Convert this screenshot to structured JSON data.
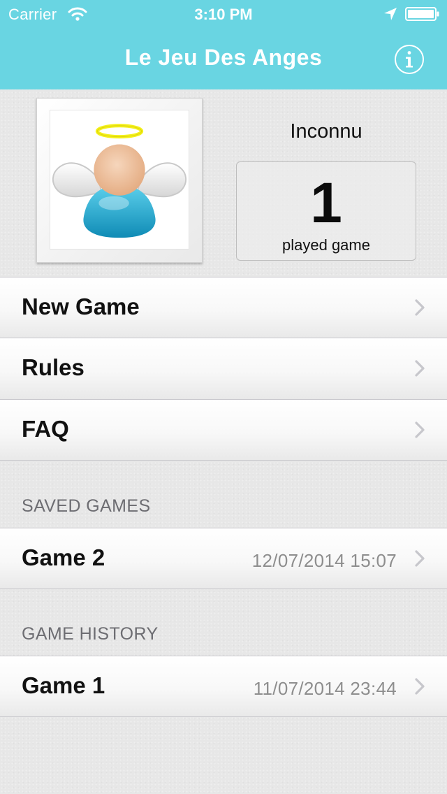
{
  "status_bar": {
    "carrier": "Carrier",
    "time": "3:10 PM",
    "icons": [
      "wifi-icon",
      "location-arrow-icon",
      "battery-icon"
    ]
  },
  "nav": {
    "title": "Le Jeu Des Anges",
    "info_icon": "info-icon"
  },
  "profile": {
    "avatar_icon": "angel-avatar-icon",
    "name": "Inconnu",
    "played_count": "1",
    "played_label": "played game"
  },
  "menu": {
    "items": [
      {
        "label": "New Game"
      },
      {
        "label": "Rules"
      },
      {
        "label": "FAQ"
      }
    ]
  },
  "saved_games": {
    "header": "SAVED GAMES",
    "items": [
      {
        "title": "Game 2",
        "date": "12/07/2014 15:07"
      }
    ]
  },
  "game_history": {
    "header": "GAME HISTORY",
    "items": [
      {
        "title": "Game 1",
        "date": "11/07/2014 23:44"
      }
    ]
  },
  "colors": {
    "nav_background": "#69d5e2",
    "halo": "#f3f01a",
    "robe": "#1ea2c8",
    "face": "#efbd95",
    "chevron": "#c7c7cc",
    "detail_text": "#8e8e8e"
  }
}
